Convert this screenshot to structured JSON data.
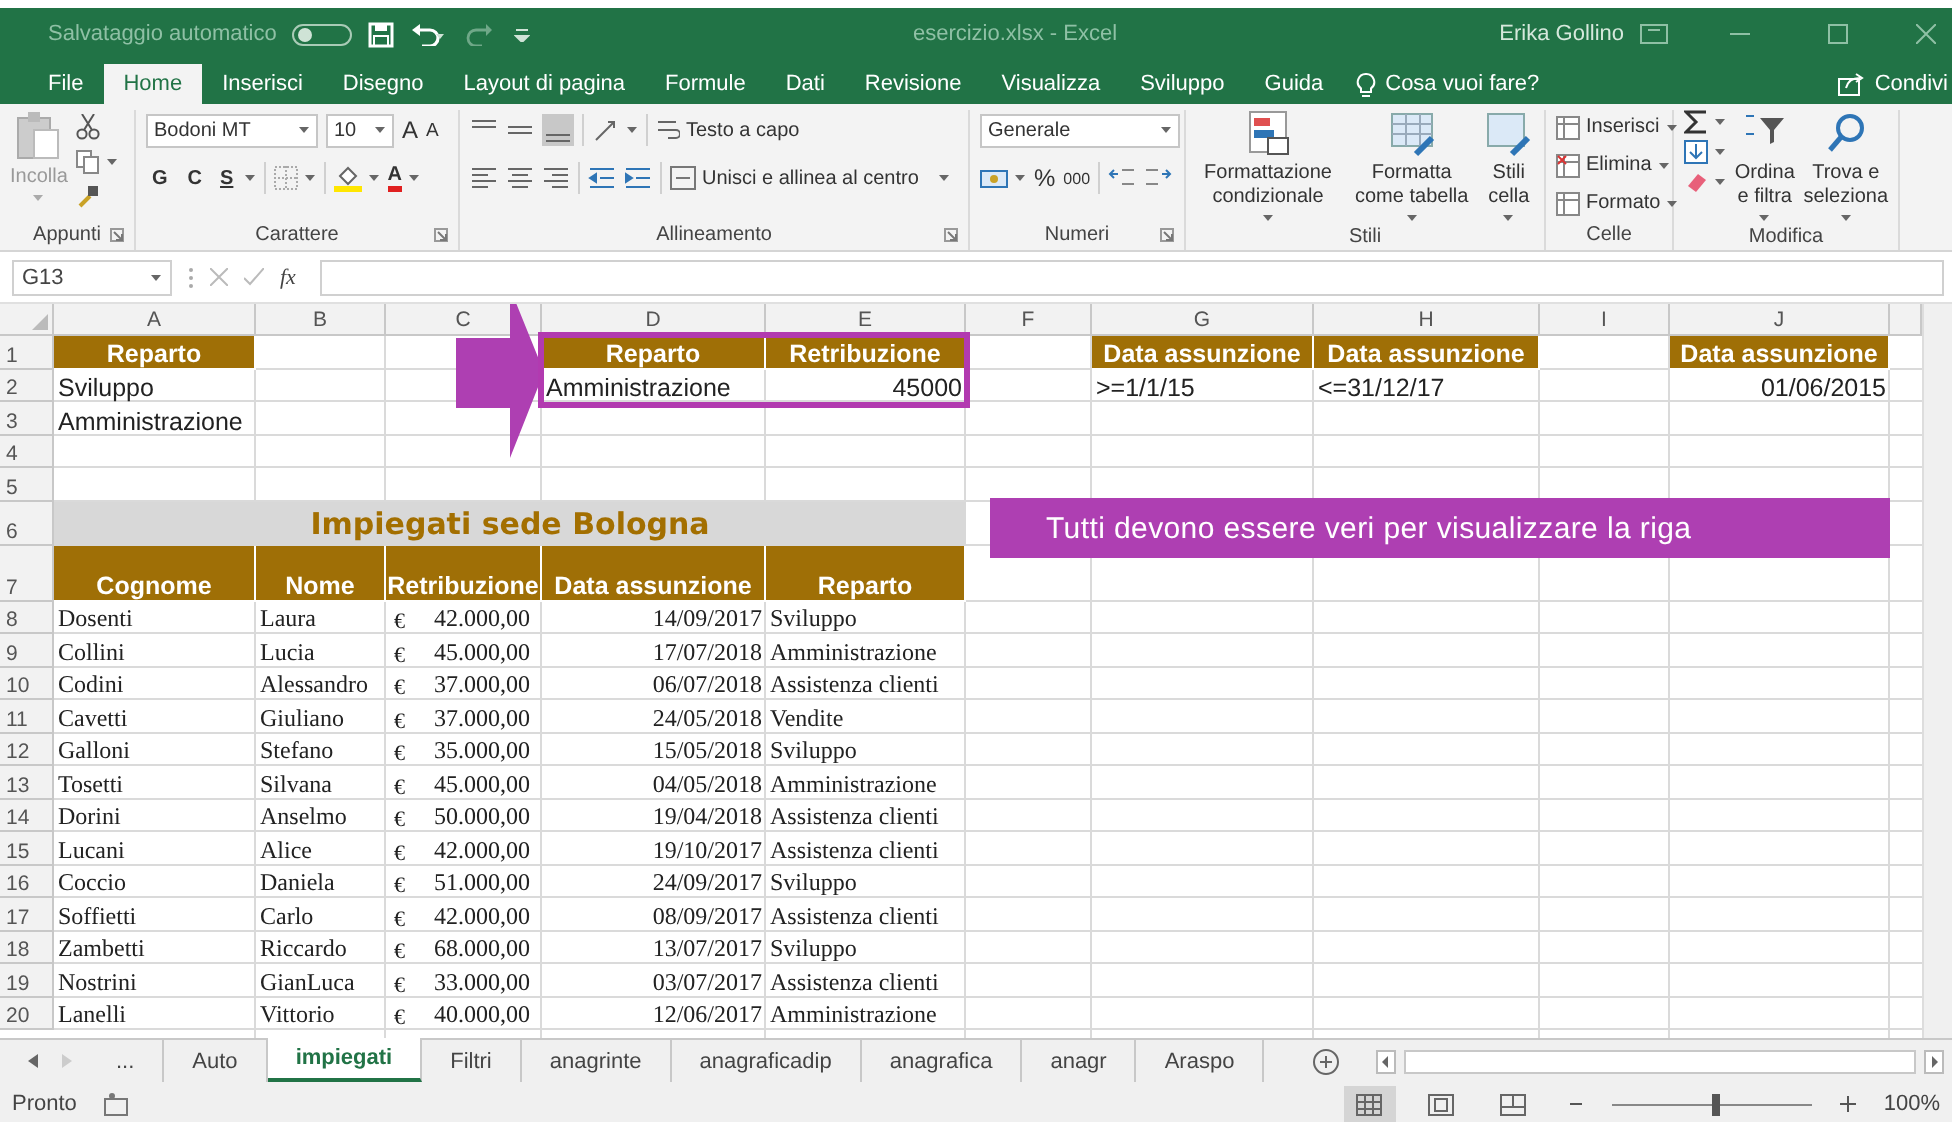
{
  "title_bar": {
    "autosave_label": "Salvataggio automatico",
    "autosave_on": false,
    "file_title": "esercizio.xlsx - Excel",
    "user": "Erika Gollino"
  },
  "ribbon_tabs": [
    {
      "label": "File",
      "selected": false
    },
    {
      "label": "Home",
      "selected": true
    },
    {
      "label": "Inserisci",
      "selected": false
    },
    {
      "label": "Disegno",
      "selected": false
    },
    {
      "label": "Layout di pagina",
      "selected": false
    },
    {
      "label": "Formule",
      "selected": false
    },
    {
      "label": "Dati",
      "selected": false
    },
    {
      "label": "Revisione",
      "selected": false
    },
    {
      "label": "Visualizza",
      "selected": false
    },
    {
      "label": "Sviluppo",
      "selected": false
    },
    {
      "label": "Guida",
      "selected": false
    }
  ],
  "tell_me": "Cosa vuoi fare?",
  "share": "Condivi",
  "ribbon": {
    "groups": [
      {
        "kind": "clipboard",
        "label": "Appunti",
        "launcher": true,
        "paste": "Incolla"
      },
      {
        "kind": "font",
        "label": "Carattere",
        "launcher": true,
        "font": "Bodoni MT",
        "size": "10",
        "grow": "A",
        "shrink": "A",
        "bold": "G",
        "italic": "C",
        "underline": "S",
        "font_color": "A"
      },
      {
        "kind": "alignment",
        "label": "Allineamento",
        "launcher": true,
        "wrap": "Testo a capo",
        "merge": "Unisci e allinea al centro"
      },
      {
        "kind": "number",
        "label": "Numeri",
        "launcher": true,
        "format": "Generale",
        "percent": "%",
        "thousands": "000"
      },
      {
        "kind": "styles",
        "label": "Stili",
        "launcher": false,
        "buttons": [
          "Formattazione condizionale",
          "Formatta come tabella",
          "Stili cella"
        ]
      },
      {
        "kind": "cells",
        "label": "Celle",
        "launcher": false,
        "buttons": [
          "Inserisci",
          "Elimina",
          "Formato"
        ]
      },
      {
        "kind": "editing",
        "label": "Modifica",
        "launcher": false,
        "buttons": [
          "Ordina e filtra",
          "Trova e seleziona"
        ]
      }
    ]
  },
  "formula_bar": {
    "name_box": "G13",
    "fx": "fx"
  },
  "sheet": {
    "columns": [
      "A",
      "B",
      "C",
      "D",
      "E",
      "F",
      "G",
      "H",
      "I",
      "J"
    ],
    "rows": [
      {
        "number": "1",
        "kind": "plain",
        "cells": [
          {
            "kind": "header",
            "text": "Reparto",
            "outlined": false
          },
          null,
          null,
          {
            "kind": "header",
            "text": "Reparto",
            "outlined": true
          },
          {
            "kind": "header",
            "text": "Retribuzione",
            "outlined": true
          },
          null,
          {
            "kind": "header",
            "text": "Data assunzione",
            "outlined": false
          },
          {
            "kind": "header",
            "text": "Data assunzione",
            "outlined": false
          },
          null,
          {
            "kind": "header",
            "text": "Data assunzione",
            "outlined": false
          }
        ]
      },
      {
        "number": "2",
        "kind": "plain",
        "cells": [
          {
            "kind": "text",
            "text": "Sviluppo",
            "outlined": false
          },
          null,
          null,
          {
            "kind": "text",
            "text": "Amministrazione",
            "outlined": true
          },
          {
            "kind": "number",
            "text": "45000",
            "outlined": true
          },
          null,
          {
            "kind": "text",
            "text": ">=1/1/15",
            "outlined": false
          },
          {
            "kind": "text",
            "text": "<=31/12/17",
            "outlined": false
          },
          null,
          {
            "kind": "number",
            "text": "01/06/2015",
            "outlined": false
          }
        ]
      },
      {
        "number": "3",
        "kind": "plain",
        "cells": [
          {
            "kind": "text",
            "text": "Amministrazione"
          },
          null,
          null,
          null,
          null,
          null,
          null,
          null,
          null,
          null
        ]
      },
      {
        "number": "4",
        "kind": "plain",
        "cells": [
          null,
          null,
          null,
          null,
          null,
          null,
          null,
          null,
          null,
          null
        ]
      },
      {
        "number": "5",
        "kind": "plain",
        "cells": [
          null,
          null,
          null,
          null,
          null,
          null,
          null,
          null,
          null,
          null
        ]
      },
      {
        "number": "6",
        "kind": "title",
        "cells": [
          null,
          null,
          {
            "kind": "title",
            "text": "Impiegati sede Bologna"
          },
          null,
          null,
          null,
          null,
          null,
          null,
          null
        ]
      },
      {
        "number": "7",
        "kind": "table_header",
        "cells": [
          {
            "kind": "header",
            "text": "Cognome"
          },
          {
            "kind": "header",
            "text": "Nome"
          },
          {
            "kind": "header",
            "text": "Retribuzione"
          },
          {
            "kind": "header",
            "text": "Data assunzione"
          },
          {
            "kind": "header",
            "text": "Reparto"
          },
          null,
          null,
          null,
          null,
          null
        ]
      },
      {
        "number": "8",
        "kind": "data",
        "cells": [
          {
            "kind": "text",
            "text": "Dosenti"
          },
          {
            "kind": "text",
            "text": "Laura"
          },
          {
            "kind": "currency",
            "symbol": "€",
            "text": "42.000,00"
          },
          {
            "kind": "number",
            "text": "14/09/2017"
          },
          {
            "kind": "text",
            "text": "Sviluppo"
          },
          null,
          null,
          null,
          null,
          null
        ]
      },
      {
        "number": "9",
        "kind": "data",
        "cells": [
          {
            "kind": "text",
            "text": "Collini"
          },
          {
            "kind": "text",
            "text": "Lucia"
          },
          {
            "kind": "currency",
            "symbol": "€",
            "text": "45.000,00"
          },
          {
            "kind": "number",
            "text": "17/07/2018"
          },
          {
            "kind": "text",
            "text": "Amministrazione"
          },
          null,
          null,
          null,
          null,
          null
        ]
      },
      {
        "number": "10",
        "kind": "data",
        "cells": [
          {
            "kind": "text",
            "text": "Codini"
          },
          {
            "kind": "text",
            "text": "Alessandro"
          },
          {
            "kind": "currency",
            "symbol": "€",
            "text": "37.000,00"
          },
          {
            "kind": "number",
            "text": "06/07/2018"
          },
          {
            "kind": "text",
            "text": "Assistenza clienti"
          },
          null,
          null,
          null,
          null,
          null
        ]
      },
      {
        "number": "11",
        "kind": "data",
        "cells": [
          {
            "kind": "text",
            "text": "Cavetti"
          },
          {
            "kind": "text",
            "text": "Giuliano"
          },
          {
            "kind": "currency",
            "symbol": "€",
            "text": "37.000,00"
          },
          {
            "kind": "number",
            "text": "24/05/2018"
          },
          {
            "kind": "text",
            "text": "Vendite"
          },
          null,
          null,
          null,
          null,
          null
        ]
      },
      {
        "number": "12",
        "kind": "data",
        "cells": [
          {
            "kind": "text",
            "text": "Galloni"
          },
          {
            "kind": "text",
            "text": "Stefano"
          },
          {
            "kind": "currency",
            "symbol": "€",
            "text": "35.000,00"
          },
          {
            "kind": "number",
            "text": "15/05/2018"
          },
          {
            "kind": "text",
            "text": "Sviluppo"
          },
          null,
          null,
          null,
          null,
          null
        ]
      },
      {
        "number": "13",
        "kind": "data",
        "cells": [
          {
            "kind": "text",
            "text": "Tosetti"
          },
          {
            "kind": "text",
            "text": "Silvana"
          },
          {
            "kind": "currency",
            "symbol": "€",
            "text": "45.000,00"
          },
          {
            "kind": "number",
            "text": "04/05/2018"
          },
          {
            "kind": "text",
            "text": "Amministrazione"
          },
          null,
          null,
          null,
          null,
          null
        ]
      },
      {
        "number": "14",
        "kind": "data",
        "cells": [
          {
            "kind": "text",
            "text": "Dorini"
          },
          {
            "kind": "text",
            "text": "Anselmo"
          },
          {
            "kind": "currency",
            "symbol": "€",
            "text": "50.000,00"
          },
          {
            "kind": "number",
            "text": "19/04/2018"
          },
          {
            "kind": "text",
            "text": "Assistenza clienti"
          },
          null,
          null,
          null,
          null,
          null
        ]
      },
      {
        "number": "15",
        "kind": "data",
        "cells": [
          {
            "kind": "text",
            "text": "Lucani"
          },
          {
            "kind": "text",
            "text": "Alice"
          },
          {
            "kind": "currency",
            "symbol": "€",
            "text": "42.000,00"
          },
          {
            "kind": "number",
            "text": "19/10/2017"
          },
          {
            "kind": "text",
            "text": "Assistenza clienti"
          },
          null,
          null,
          null,
          null,
          null
        ]
      },
      {
        "number": "16",
        "kind": "data",
        "cells": [
          {
            "kind": "text",
            "text": "Coccio"
          },
          {
            "kind": "text",
            "text": "Daniela"
          },
          {
            "kind": "currency",
            "symbol": "€",
            "text": "51.000,00"
          },
          {
            "kind": "number",
            "text": "24/09/2017"
          },
          {
            "kind": "text",
            "text": "Sviluppo"
          },
          null,
          null,
          null,
          null,
          null
        ]
      },
      {
        "number": "17",
        "kind": "data",
        "cells": [
          {
            "kind": "text",
            "text": "Soffietti"
          },
          {
            "kind": "text",
            "text": "Carlo"
          },
          {
            "kind": "currency",
            "symbol": "€",
            "text": "42.000,00"
          },
          {
            "kind": "number",
            "text": "08/09/2017"
          },
          {
            "kind": "text",
            "text": "Assistenza clienti"
          },
          null,
          null,
          null,
          null,
          null
        ]
      },
      {
        "number": "18",
        "kind": "data",
        "cells": [
          {
            "kind": "text",
            "text": "Zambetti"
          },
          {
            "kind": "text",
            "text": "Riccardo"
          },
          {
            "kind": "currency",
            "symbol": "€",
            "text": "68.000,00"
          },
          {
            "kind": "number",
            "text": "13/07/2017"
          },
          {
            "kind": "text",
            "text": "Sviluppo"
          },
          null,
          null,
          null,
          null,
          null
        ]
      },
      {
        "number": "19",
        "kind": "data",
        "cells": [
          {
            "kind": "text",
            "text": "Nostrini"
          },
          {
            "kind": "text",
            "text": "GianLuca"
          },
          {
            "kind": "currency",
            "symbol": "€",
            "text": "33.000,00"
          },
          {
            "kind": "number",
            "text": "03/07/2017"
          },
          {
            "kind": "text",
            "text": "Assistenza clienti"
          },
          null,
          null,
          null,
          null,
          null
        ]
      },
      {
        "number": "20",
        "kind": "data",
        "cells": [
          {
            "kind": "text",
            "text": "Lanelli"
          },
          {
            "kind": "text",
            "text": "Vittorio"
          },
          {
            "kind": "currency",
            "symbol": "€",
            "text": "40.000,00"
          },
          {
            "kind": "number",
            "text": "12/06/2017"
          },
          {
            "kind": "text",
            "text": "Amministrazione"
          },
          null,
          null,
          null,
          null,
          null
        ]
      }
    ],
    "callout": {
      "text": "Tutti devono essere veri per visualizzare la riga"
    }
  },
  "sheet_tabs": {
    "overflow": "...",
    "tabs": [
      {
        "label": "Auto",
        "selected": false
      },
      {
        "label": "impiegati",
        "selected": true
      },
      {
        "label": "Filtri",
        "selected": false
      },
      {
        "label": "anagrinte",
        "selected": false
      },
      {
        "label": "anagraficadip",
        "selected": false
      },
      {
        "label": "anagrafica",
        "selected": false
      },
      {
        "label": "anagr",
        "selected": false
      },
      {
        "label": "Araspo",
        "selected": false
      }
    ]
  },
  "status_bar": {
    "status": "Pronto",
    "views": [
      {
        "kind": "normal",
        "selected": true
      },
      {
        "kind": "page_layout",
        "selected": false
      },
      {
        "kind": "page_break",
        "selected": false
      }
    ],
    "zoom": {
      "level": 0.52,
      "reading": "100%"
    }
  }
}
